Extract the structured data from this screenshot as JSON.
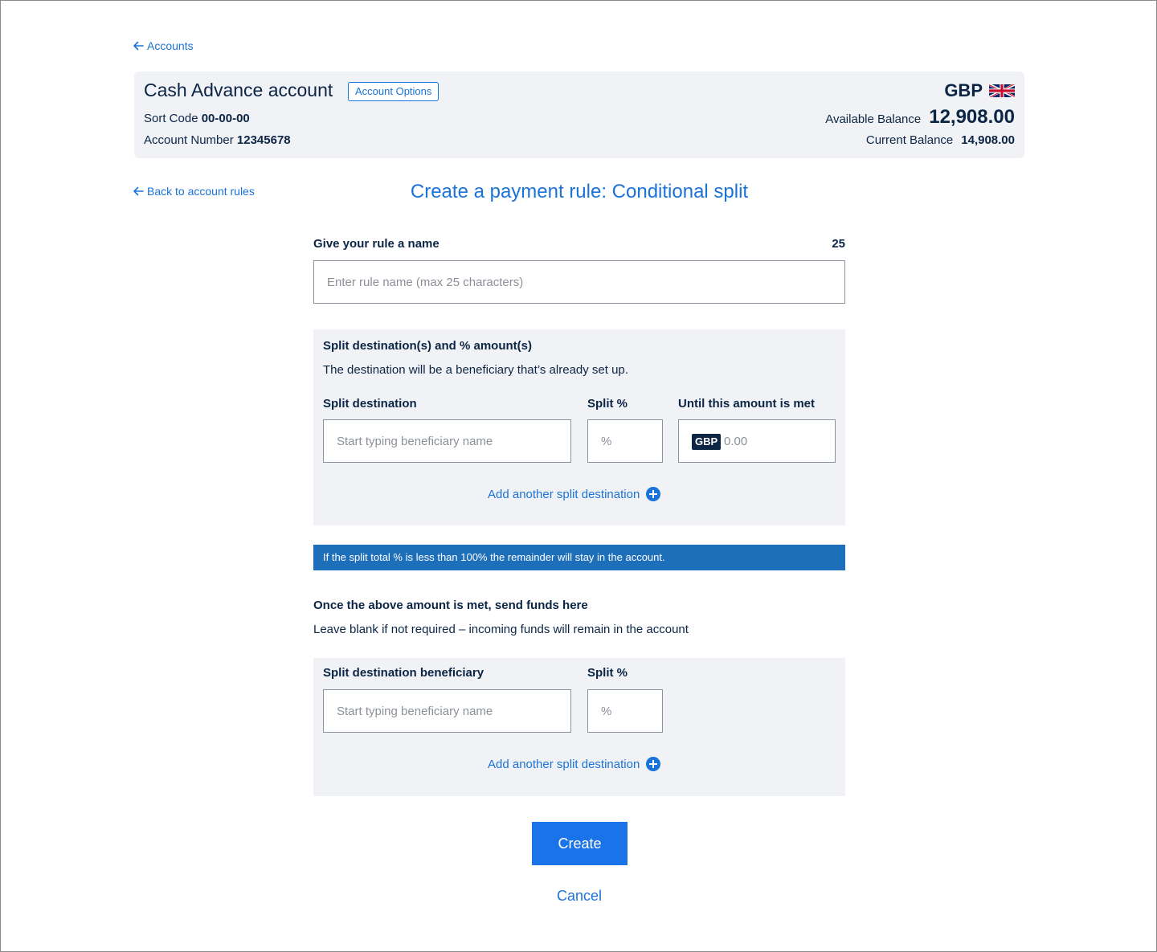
{
  "nav": {
    "accounts_link": "Accounts",
    "back_to_rules_link": "Back to account rules"
  },
  "account": {
    "name": "Cash Advance account",
    "options_button": "Account Options",
    "sort_code_label": "Sort Code",
    "sort_code": "00-00-00",
    "account_number_label": "Account Number",
    "account_number": "12345678",
    "currency": "GBP",
    "flag_icon": "uk-flag-icon",
    "available_balance_label": "Available Balance",
    "available_balance": "12,908.00",
    "current_balance_label": "Current Balance",
    "current_balance": "14,908.00"
  },
  "page": {
    "title": "Create a payment rule: Conditional split"
  },
  "rule_name": {
    "label": "Give your rule a name",
    "char_count": "25",
    "placeholder": "Enter rule name (max 25 characters)",
    "value": ""
  },
  "split_panel": {
    "heading": "Split destination(s) and % amount(s)",
    "description": "The destination will be a beneficiary that’s already set up.",
    "destination_label": "Split destination",
    "destination_placeholder": "Start typing beneficiary name",
    "percent_label": "Split %",
    "percent_placeholder": "%",
    "amount_label": "Until this amount is met",
    "amount_currency_badge": "GBP",
    "amount_placeholder": "0.00",
    "add_link": "Add another split destination"
  },
  "info_bar": {
    "text": "If the split total % is less than 100% the remainder will stay in the account."
  },
  "after_met": {
    "heading": "Once the above amount is met, send funds here",
    "description": "Leave blank if not required – incoming funds will remain in the account",
    "beneficiary_label": "Split destination beneficiary",
    "beneficiary_placeholder": "Start typing beneficiary name",
    "percent_label": "Split %",
    "percent_placeholder": "%",
    "add_link": "Add another split destination"
  },
  "actions": {
    "create_button": "Create",
    "cancel_link": "Cancel"
  },
  "colors": {
    "accent": "#1a73d9",
    "primary_button": "#1a73e8",
    "text_dark": "#0b2545",
    "panel_bg": "#f1f2f6",
    "info_bar_bg": "#1e6fba"
  }
}
